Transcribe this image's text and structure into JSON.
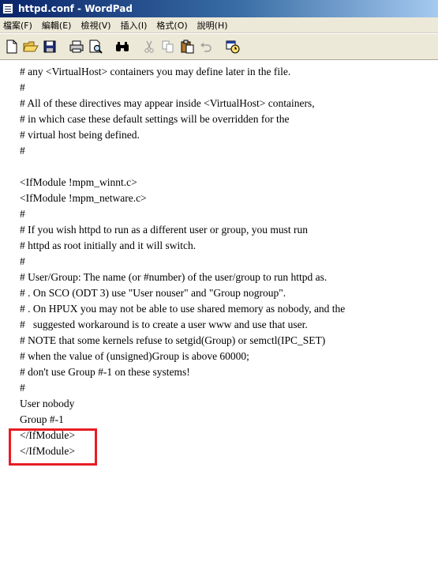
{
  "window": {
    "title": "httpd.conf - WordPad"
  },
  "menubar": {
    "items": [
      {
        "label": "檔案(F)"
      },
      {
        "label": "編輯(E)"
      },
      {
        "label": "檢視(V)"
      },
      {
        "label": "插入(I)"
      },
      {
        "label": "格式(O)"
      },
      {
        "label": "說明(H)"
      }
    ]
  },
  "toolbar": {
    "buttons": [
      "new-icon",
      "open-icon",
      "save-icon",
      "print-icon",
      "print-preview-icon",
      "find-icon",
      "cut-icon",
      "copy-icon",
      "paste-icon",
      "undo-icon",
      "date-time-icon"
    ]
  },
  "document": {
    "lines": [
      "# any <VirtualHost> containers you may define later in the file.",
      "#",
      "# All of these directives may appear inside <VirtualHost> containers,",
      "# in which case these default settings will be overridden for the",
      "# virtual host being defined.",
      "#",
      "",
      "<IfModule !mpm_winnt.c>",
      "<IfModule !mpm_netware.c>",
      "#",
      "# If you wish httpd to run as a different user or group, you must run",
      "# httpd as root initially and it will switch.",
      "#",
      "# User/Group: The name (or #number) of the user/group to run httpd as.",
      "# . On SCO (ODT 3) use \"User nouser\" and \"Group nogroup\".",
      "# . On HPUX you may not be able to use shared memory as nobody, and the",
      "#   suggested workaround is to create a user www and use that user.",
      "# NOTE that some kernels refuse to setgid(Group) or semctl(IPC_SET)",
      "# when the value of (unsigned)Group is above 60000;",
      "# don't use Group #-1 on these systems!",
      "#",
      "User nobody",
      "Group #-1",
      "</IfModule>",
      "</IfModule>"
    ]
  },
  "colors": {
    "titlebar_start": "#0a246a",
    "titlebar_end": "#a6caf0",
    "chrome": "#ece9d8",
    "highlight": "#e81c24"
  }
}
